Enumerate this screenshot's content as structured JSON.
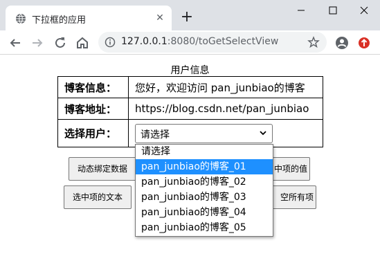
{
  "browser": {
    "tab_title": "下拉框的应用",
    "url_host": "127.0.0.1",
    "url_rest": ":8080/toGetSelectView"
  },
  "page": {
    "title": "用户信息",
    "rows": [
      {
        "label": "博客信息：",
        "value": "您好，欢迎访问 pan_junbiao的博客"
      },
      {
        "label": "博客地址：",
        "value": "https://blog.csdn.net/pan_junbiao"
      },
      {
        "label": "选择用户：",
        "value": "请选择"
      }
    ],
    "select": {
      "selected": "请选择",
      "options": [
        "请选择",
        "pan_junbiao的博客_01",
        "pan_junbiao的博客_02",
        "pan_junbiao的博客_03",
        "pan_junbiao的博客_04",
        "pan_junbiao的博客_05"
      ],
      "highlighted_index": 1
    },
    "buttons": {
      "bind": "动态绑定数据",
      "value": "中项的值",
      "text": "选中项的文本",
      "clear": "空所有项"
    }
  },
  "colors": {
    "highlight": "#1e90ff",
    "titlebar": "#dee1e6",
    "profile_red": "#d93025"
  },
  "icons": {
    "favicon": "globe-icon",
    "close": "close-icon",
    "new_tab": "plus-icon",
    "back": "back-arrow-icon",
    "forward": "forward-arrow-icon",
    "reload": "reload-icon",
    "home": "home-icon",
    "info": "info-icon",
    "star": "star-icon",
    "profile": "profile-icon",
    "update": "update-icon"
  }
}
